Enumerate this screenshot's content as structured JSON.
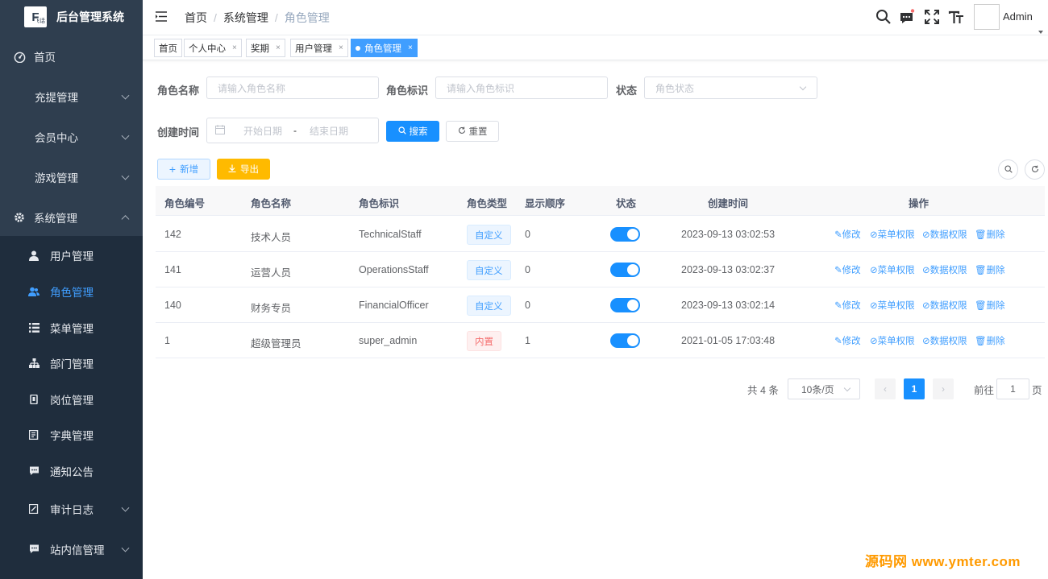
{
  "app": {
    "logo_letter": "F",
    "logo_sub": "飞话",
    "title": "后台管理系统"
  },
  "sidebar": {
    "home": "首页",
    "recharge": "充提管理",
    "member": "会员中心",
    "game": "游戏管理",
    "system": "系统管理",
    "sub_items": [
      "用户管理",
      "角色管理",
      "菜单管理",
      "部门管理",
      "岗位管理",
      "字典管理",
      "通知公告",
      "审计日志",
      "站内信管理"
    ]
  },
  "header": {
    "breadcrumb": [
      "首页",
      "系统管理",
      "角色管理"
    ],
    "user": "Admin",
    "colors": {
      "accent": "#409eff",
      "sidebar": "#2f3e4f",
      "submenu": "#1f2d3d"
    }
  },
  "tabs": [
    "首页",
    "个人中心",
    "奖期",
    "用户管理",
    "角色管理"
  ],
  "search": {
    "role_name_label": "角色名称",
    "role_name_placeholder": "请输入角色名称",
    "role_key_label": "角色标识",
    "role_key_placeholder": "请输入角色标识",
    "status_label": "状态",
    "status_placeholder": "角色状态",
    "created_label": "创建时间",
    "start_placeholder": "开始日期",
    "range_sep": "-",
    "end_placeholder": "结束日期",
    "search_btn": "搜索",
    "reset_btn": "重置"
  },
  "toolbar": {
    "add": "新增",
    "export": "导出"
  },
  "table": {
    "headers": [
      "角色编号",
      "角色名称",
      "角色标识",
      "角色类型",
      "显示顺序",
      "状态",
      "创建时间",
      "操作"
    ],
    "rows": [
      {
        "id": "142",
        "name": "技术人员",
        "key": "TechnicalStaff",
        "type": "自定义",
        "order": "0",
        "created": "2023-09-13 03:02:53"
      },
      {
        "id": "141",
        "name": "运营人员",
        "key": "OperationsStaff",
        "type": "自定义",
        "order": "0",
        "created": "2023-09-13 03:02:37"
      },
      {
        "id": "140",
        "name": "财务专员",
        "key": "FinancialOfficer",
        "type": "自定义",
        "order": "0",
        "created": "2023-09-13 03:02:14"
      },
      {
        "id": "1",
        "name": "超级管理员",
        "key": "super_admin",
        "type": "内置",
        "order": "1",
        "created": "2021-01-05 17:03:48"
      }
    ],
    "actions": [
      "修改",
      "菜单权限",
      "数据权限",
      "删除"
    ]
  },
  "pagination": {
    "total": "共 4 条",
    "page_size": "10条/页",
    "current": "1",
    "goto_label": "前往",
    "goto_value": "1",
    "page_suffix": "页"
  },
  "watermark": "源码网 www.ymter.com"
}
